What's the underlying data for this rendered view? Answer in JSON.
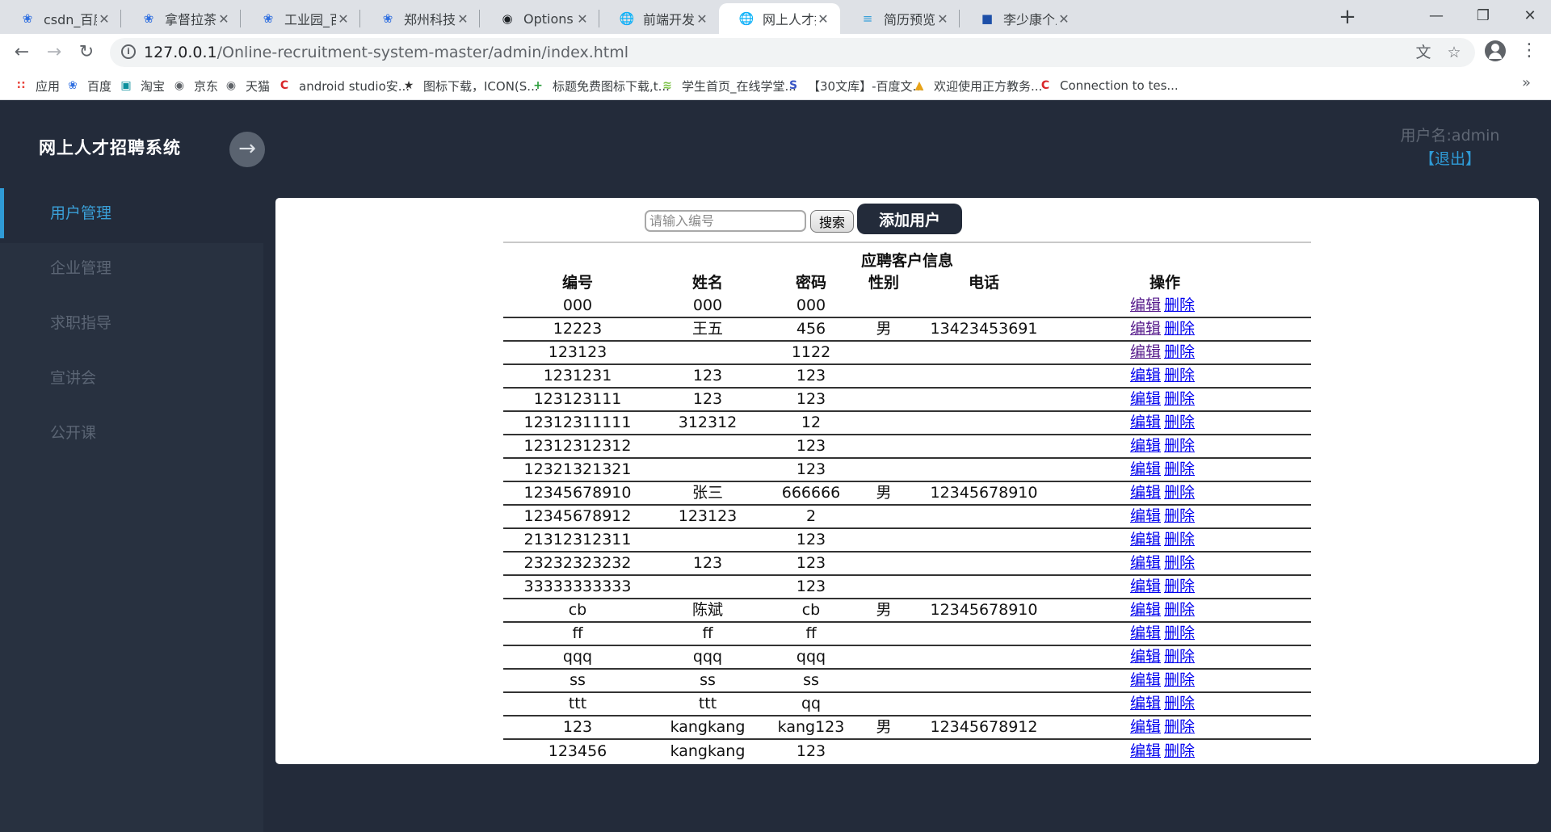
{
  "browser": {
    "tabs": [
      {
        "title": "csdn_百度搜索",
        "icon": "baidu-icon"
      },
      {
        "title": "拿督拉茶图片_",
        "icon": "baidu-icon"
      },
      {
        "title": "工业园_百度图",
        "icon": "baidu-icon"
      },
      {
        "title": "郑州科技学院",
        "icon": "baidu-icon"
      },
      {
        "title": "Options",
        "icon": "github-icon"
      },
      {
        "title": "前端开发工程",
        "icon": "globe-icon"
      },
      {
        "title": "网上人才招聘",
        "icon": "globe-icon",
        "active": true
      },
      {
        "title": "简历预览-网上",
        "icon": "resume-icon"
      },
      {
        "title": "李少康个人简",
        "icon": "flag-icon"
      }
    ],
    "url_host": "127.0.0.1",
    "url_path": "/Online-recruitment-system-master/admin/index.html",
    "bookmarks": [
      {
        "label": "应用",
        "icon": "apps-icon"
      },
      {
        "label": "百度",
        "icon": "baidu-icon"
      },
      {
        "label": "淘宝",
        "icon": "taobao-icon"
      },
      {
        "label": "京东",
        "icon": "globe-icon"
      },
      {
        "label": "天猫",
        "icon": "globe-icon"
      },
      {
        "label": "android studio安...",
        "icon": "csdn-icon"
      },
      {
        "label": "图标下载，ICON(S...",
        "icon": "iconfont-icon"
      },
      {
        "label": "标题免费图标下载,t...",
        "icon": "plus-green-icon"
      },
      {
        "label": "学生首页_在线学堂...",
        "icon": "wave-icon"
      },
      {
        "label": "【30文库】-百度文...",
        "icon": "s-icon"
      },
      {
        "label": "欢迎使用正方教务...",
        "icon": "cube-icon"
      },
      {
        "label": "Connection to tes...",
        "icon": "csdn-icon"
      }
    ],
    "bookmarks_more": "»"
  },
  "header": {
    "title": "网上人才招聘系统",
    "user_label": "用户名:admin",
    "logout_label": "【退出】"
  },
  "sidebar": {
    "items": [
      {
        "label": "用户管理",
        "active": true
      },
      {
        "label": "企业管理"
      },
      {
        "label": "求职指导"
      },
      {
        "label": "宣讲会"
      },
      {
        "label": "公开课"
      }
    ]
  },
  "toolbar": {
    "search_placeholder": "请输入编号",
    "search_label": "搜索",
    "add_label": "添加用户"
  },
  "table": {
    "caption": "应聘客户信息",
    "columns": [
      "编号",
      "姓名",
      "密码",
      "性别",
      "电话",
      "操作"
    ],
    "edit_label": "编辑",
    "delete_label": "删除",
    "rows": [
      [
        "000",
        "000",
        "000",
        "",
        ""
      ],
      [
        "12223",
        "王五",
        "456",
        "男",
        "13423453691"
      ],
      [
        "123123",
        "",
        "1122",
        "",
        ""
      ],
      [
        "1231231",
        "123",
        "123",
        "",
        ""
      ],
      [
        "123123111",
        "123",
        "123",
        "",
        ""
      ],
      [
        "12312311111",
        "312312",
        "12",
        "",
        ""
      ],
      [
        "12312312312",
        "",
        "123",
        "",
        ""
      ],
      [
        "12321321321",
        "",
        "123",
        "",
        ""
      ],
      [
        "12345678910",
        "张三",
        "666666",
        "男",
        "12345678910"
      ],
      [
        "12345678912",
        "123123",
        "2",
        "",
        ""
      ],
      [
        "21312312311",
        "",
        "123",
        "",
        ""
      ],
      [
        "23232323232",
        "123",
        "123",
        "",
        ""
      ],
      [
        "33333333333",
        "",
        "123",
        "",
        ""
      ],
      [
        "cb",
        "陈斌",
        "cb",
        "男",
        "12345678910"
      ],
      [
        "ff",
        "ff",
        "ff",
        "",
        ""
      ],
      [
        "qqq",
        "qqq",
        "qqq",
        "",
        ""
      ],
      [
        "ss",
        "ss",
        "ss",
        "",
        ""
      ],
      [
        "ttt",
        "ttt",
        "qq",
        "",
        ""
      ],
      [
        "123",
        "kangkang",
        "kang123",
        "男",
        "12345678912"
      ],
      [
        "123456",
        "kangkang",
        "123",
        "",
        ""
      ]
    ]
  }
}
